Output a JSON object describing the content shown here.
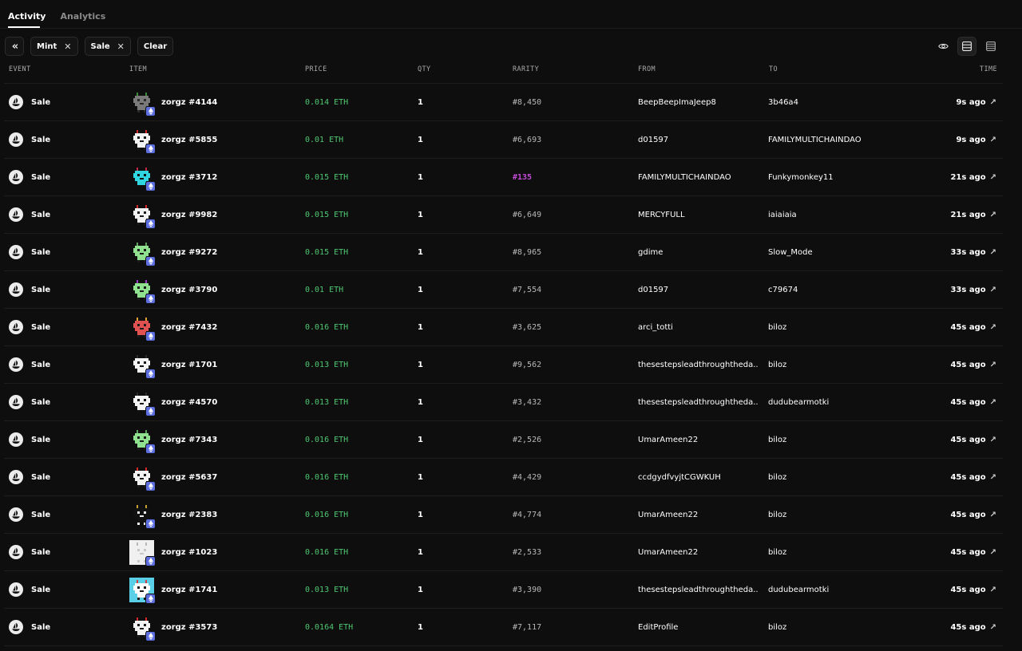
{
  "tabs": [
    {
      "label": "Activity",
      "active": true
    },
    {
      "label": "Analytics",
      "active": false
    }
  ],
  "filters": {
    "collapse_icon": "double-chevron-left-icon",
    "chips": [
      {
        "label": "Mint"
      },
      {
        "label": "Sale"
      }
    ],
    "clear_label": "Clear"
  },
  "view_tools": [
    "eye-icon",
    "list-compact-icon",
    "list-dense-icon"
  ],
  "table": {
    "columns": [
      "EVENT",
      "ITEM",
      "PRICE",
      "QTY",
      "RARITY",
      "FROM",
      "TO",
      "TIME"
    ],
    "rows": [
      {
        "event": "Sale",
        "item": "zorgz #4144",
        "price": "0.014 ETH",
        "qty": "1",
        "rarity": "#8,450",
        "from": "BeepBeepImaJeep8",
        "to": "3b46a4",
        "time": "9s ago",
        "art": "gray"
      },
      {
        "event": "Sale",
        "item": "zorgz #5855",
        "price": "0.01 ETH",
        "qty": "1",
        "rarity": "#6,693",
        "from": "d01597",
        "to": "FAMILYMULTICHAINDAO",
        "time": "9s ago",
        "art": "white-red"
      },
      {
        "event": "Sale",
        "item": "zorgz #3712",
        "price": "0.015 ETH",
        "qty": "1",
        "rarity": "#135",
        "from": "FAMILYMULTICHAINDAO",
        "to": "Funkymonkey11",
        "time": "21s ago",
        "art": "cyan",
        "top": true
      },
      {
        "event": "Sale",
        "item": "zorgz #9982",
        "price": "0.015 ETH",
        "qty": "1",
        "rarity": "#6,649",
        "from": "MERCYFULL",
        "to": "iaiaiaia",
        "time": "21s ago",
        "art": "white-red"
      },
      {
        "event": "Sale",
        "item": "zorgz #9272",
        "price": "0.015 ETH",
        "qty": "1",
        "rarity": "#8,965",
        "from": "gdime",
        "to": "Slow_Mode",
        "time": "33s ago",
        "art": "green"
      },
      {
        "event": "Sale",
        "item": "zorgz #3790",
        "price": "0.01 ETH",
        "qty": "1",
        "rarity": "#7,554",
        "from": "d01597",
        "to": "c79674",
        "time": "33s ago",
        "art": "green-purple"
      },
      {
        "event": "Sale",
        "item": "zorgz #7432",
        "price": "0.016 ETH",
        "qty": "1",
        "rarity": "#3,625",
        "from": "arci_totti",
        "to": "biloz",
        "time": "45s ago",
        "art": "red"
      },
      {
        "event": "Sale",
        "item": "zorgz #1701",
        "price": "0.013 ETH",
        "qty": "1",
        "rarity": "#9,562",
        "from": "thesestepsleadthroughtheda...",
        "to": "biloz",
        "time": "45s ago",
        "art": "white"
      },
      {
        "event": "Sale",
        "item": "zorgz #4570",
        "price": "0.013 ETH",
        "qty": "1",
        "rarity": "#3,432",
        "from": "thesestepsleadthroughtheda...",
        "to": "dudubearmotki",
        "time": "45s ago",
        "art": "white"
      },
      {
        "event": "Sale",
        "item": "zorgz #7343",
        "price": "0.016 ETH",
        "qty": "1",
        "rarity": "#2,526",
        "from": "UmarAmeen22",
        "to": "biloz",
        "time": "45s ago",
        "art": "green"
      },
      {
        "event": "Sale",
        "item": "zorgz #5637",
        "price": "0.016 ETH",
        "qty": "1",
        "rarity": "#4,429",
        "from": "ccdgydfvyjtCGWKUH",
        "to": "biloz",
        "time": "45s ago",
        "art": "white-red"
      },
      {
        "event": "Sale",
        "item": "zorgz #2383",
        "price": "0.016 ETH",
        "qty": "1",
        "rarity": "#4,774",
        "from": "UmarAmeen22",
        "to": "biloz",
        "time": "45s ago",
        "art": "black-white"
      },
      {
        "event": "Sale",
        "item": "zorgz #1023",
        "price": "0.016 ETH",
        "qty": "1",
        "rarity": "#2,533",
        "from": "UmarAmeen22",
        "to": "biloz",
        "time": "45s ago",
        "art": "white-block"
      },
      {
        "event": "Sale",
        "item": "zorgz #1741",
        "price": "0.013 ETH",
        "qty": "1",
        "rarity": "#3,390",
        "from": "thesestepsleadthroughtheda...",
        "to": "dudubearmotki",
        "time": "45s ago",
        "art": "cyan-white"
      },
      {
        "event": "Sale",
        "item": "zorgz #3573",
        "price": "0.0164 ETH",
        "qty": "1",
        "rarity": "#7,117",
        "from": "EditProfile",
        "to": "biloz",
        "time": "45s ago",
        "art": "white-red"
      }
    ]
  },
  "colors": {
    "background": "#0e0e0e",
    "price_green": "#4ec771",
    "rarity_top": "#c44cd8",
    "chain_badge": "#5d6fe0"
  },
  "art_palettes": {
    "gray": {
      "body": "#7a7a7a",
      "dark": "#2a2a2a",
      "accent": "#3a8a3a",
      "bg": "transparent"
    },
    "white-red": {
      "body": "#f2f2f2",
      "dark": "#1a1a1a",
      "accent": "#d42a2a",
      "bg": "transparent"
    },
    "cyan": {
      "body": "#2fd6e0",
      "dark": "#101010",
      "accent": "#c0284a",
      "bg": "transparent"
    },
    "green": {
      "body": "#8fe08f",
      "dark": "#1a1a1a",
      "accent": "#5fa05f",
      "bg": "transparent"
    },
    "green-purple": {
      "body": "#8fe08f",
      "dark": "#1a1a1a",
      "accent": "#9a3ac8",
      "bg": "transparent"
    },
    "red": {
      "body": "#e05252",
      "dark": "#1a1a1a",
      "accent": "#e0a030",
      "bg": "transparent"
    },
    "white": {
      "body": "#f4f4f4",
      "dark": "#121212",
      "accent": "#2a2a2a",
      "bg": "transparent"
    },
    "black-white": {
      "body": "#111111",
      "dark": "#f0f0f0",
      "accent": "#c8a030",
      "bg": "transparent"
    },
    "white-block": {
      "body": "#f0f0f0",
      "dark": "#c8c8c8",
      "accent": "#b8b8b8",
      "bg": "#f0f0f0"
    },
    "cyan-white": {
      "body": "#ffffff",
      "dark": "#1a1a1a",
      "accent": "#d44040",
      "bg": "#5ad0e8"
    }
  }
}
